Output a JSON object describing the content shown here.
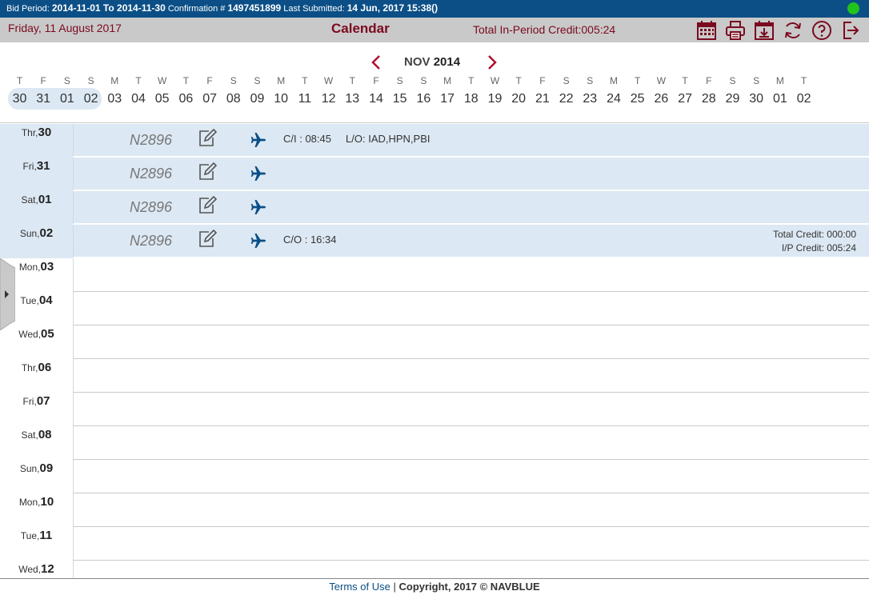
{
  "topbar": {
    "bid_period_label": "Bid Period:",
    "bid_period_value": "2014-11-01 To 2014-11-30",
    "confirmation_label": "Confirmation #",
    "confirmation_value": "1497451899",
    "last_submitted_label": "Last Submitted:",
    "last_submitted_value": "14 Jun, 2017 15:38()",
    "status_color": "#22c31c"
  },
  "header": {
    "date": "Friday, 11 August 2017",
    "title": "Calendar",
    "credit": "Total In-Period Credit:005:24",
    "icons": [
      "calendar-icon",
      "print-icon",
      "download-icon",
      "refresh-icon",
      "help-icon",
      "logout-icon"
    ],
    "accent": "#7a0a20"
  },
  "month_nav": {
    "month": "NOV",
    "year": "2014"
  },
  "date_strip": [
    {
      "dow": "T",
      "day": "30"
    },
    {
      "dow": "F",
      "day": "31"
    },
    {
      "dow": "S",
      "day": "01"
    },
    {
      "dow": "S",
      "day": "02"
    },
    {
      "dow": "M",
      "day": "03"
    },
    {
      "dow": "T",
      "day": "04"
    },
    {
      "dow": "W",
      "day": "05"
    },
    {
      "dow": "T",
      "day": "06"
    },
    {
      "dow": "F",
      "day": "07"
    },
    {
      "dow": "S",
      "day": "08"
    },
    {
      "dow": "S",
      "day": "09"
    },
    {
      "dow": "M",
      "day": "10"
    },
    {
      "dow": "T",
      "day": "11"
    },
    {
      "dow": "W",
      "day": "12"
    },
    {
      "dow": "T",
      "day": "13"
    },
    {
      "dow": "F",
      "day": "14"
    },
    {
      "dow": "S",
      "day": "15"
    },
    {
      "dow": "S",
      "day": "16"
    },
    {
      "dow": "M",
      "day": "17"
    },
    {
      "dow": "T",
      "day": "18"
    },
    {
      "dow": "W",
      "day": "19"
    },
    {
      "dow": "T",
      "day": "20"
    },
    {
      "dow": "F",
      "day": "21"
    },
    {
      "dow": "S",
      "day": "22"
    },
    {
      "dow": "S",
      "day": "23"
    },
    {
      "dow": "M",
      "day": "24"
    },
    {
      "dow": "T",
      "day": "25"
    },
    {
      "dow": "W",
      "day": "26"
    },
    {
      "dow": "T",
      "day": "27"
    },
    {
      "dow": "F",
      "day": "28"
    },
    {
      "dow": "S",
      "day": "29"
    },
    {
      "dow": "S",
      "day": "30"
    },
    {
      "dow": "M",
      "day": "01"
    },
    {
      "dow": "T",
      "day": "02"
    }
  ],
  "rows": [
    {
      "dow": "Thr,",
      "day": "30",
      "trip": "N2896",
      "info": "C/I : 08:45     L/O: IAD,HPN,PBI"
    },
    {
      "dow": "Fri,",
      "day": "31",
      "trip": "N2896",
      "info": ""
    },
    {
      "dow": "Sat,",
      "day": "01",
      "trip": "N2896",
      "info": ""
    },
    {
      "dow": "Sun,",
      "day": "02",
      "trip": "N2896",
      "info": "C/O : 16:34",
      "total_credit": "Total Credit: 000:00",
      "ip_credit": "I/P Credit: 005:24"
    },
    {
      "dow": "Mon,",
      "day": "03"
    },
    {
      "dow": "Tue,",
      "day": "04"
    },
    {
      "dow": "Wed,",
      "day": "05"
    },
    {
      "dow": "Thr,",
      "day": "06"
    },
    {
      "dow": "Fri,",
      "day": "07"
    },
    {
      "dow": "Sat,",
      "day": "08"
    },
    {
      "dow": "Sun,",
      "day": "09"
    },
    {
      "dow": "Mon,",
      "day": "10"
    },
    {
      "dow": "Tue,",
      "day": "11"
    },
    {
      "dow": "Wed,",
      "day": "12"
    }
  ],
  "footer": {
    "terms": "Terms of Use",
    "sep": " | ",
    "copyright": "Copyright, 2017 © NAVBLUE"
  }
}
